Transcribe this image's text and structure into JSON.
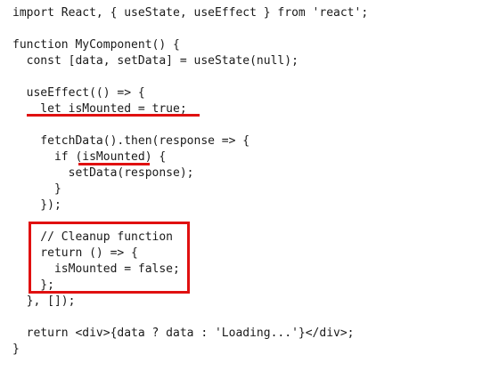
{
  "code": {
    "lines": [
      "import React, { useState, useEffect } from 'react';",
      "",
      "function MyComponent() {",
      "  const [data, setData] = useState(null);",
      "",
      "  useEffect(() => {",
      "    let isMounted = true;",
      "",
      "    fetchData().then(response => {",
      "      if (isMounted) {",
      "        setData(response);",
      "      }",
      "    });",
      "",
      "    // Cleanup function",
      "    return () => {",
      "      isMounted = false;",
      "    };",
      "  }, []);",
      "",
      "  return <div>{data ? data : 'Loading...'}</div>;",
      "}"
    ]
  },
  "colors": {
    "text": "#1a1a1a",
    "annotation": "#e01010",
    "background": "#ffffff"
  }
}
